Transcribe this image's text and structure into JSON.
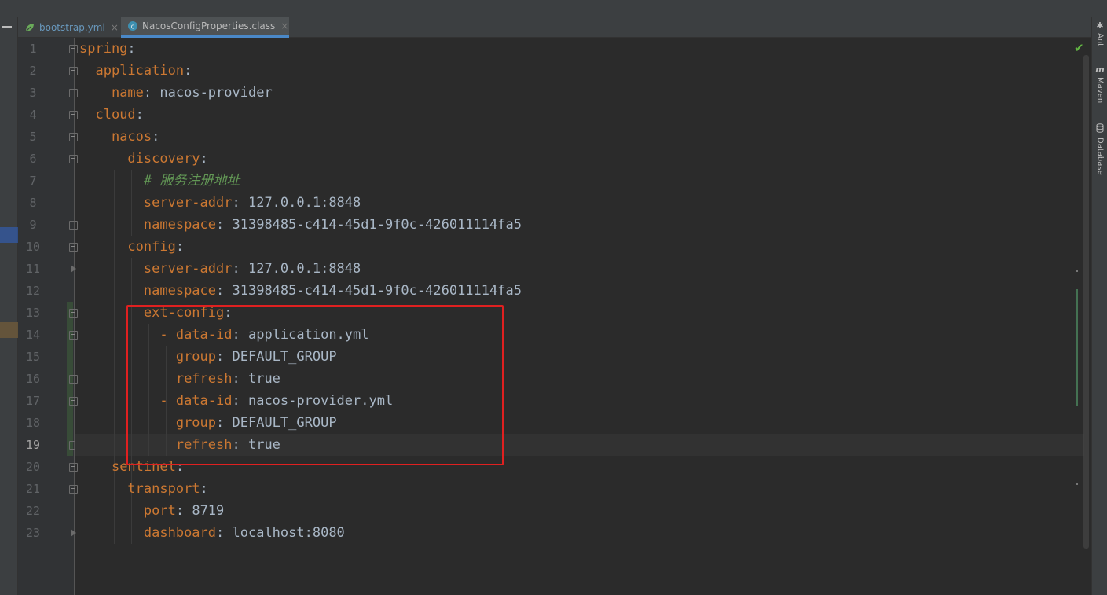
{
  "tabs": [
    {
      "label": "bootstrap.yml",
      "close": "×",
      "icon": "spring-leaf-icon"
    },
    {
      "label": "NacosConfigProperties.class",
      "close": "×",
      "icon": "class-file-icon"
    }
  ],
  "right_tools": [
    {
      "label": "Ant",
      "icon": "ant-icon"
    },
    {
      "label": "Maven",
      "icon": "maven-icon"
    },
    {
      "label": "Database",
      "icon": "database-icon"
    }
  ],
  "status": {
    "inspection": "✔"
  },
  "editor": {
    "current_line": 19,
    "lines": [
      {
        "n": "1",
        "indent": "",
        "key": "spring",
        "value": ""
      },
      {
        "n": "2",
        "indent": "  ",
        "key": "application",
        "value": ""
      },
      {
        "n": "3",
        "indent": "    ",
        "key": "name",
        "value": " nacos-provider"
      },
      {
        "n": "4",
        "indent": "  ",
        "key": "cloud",
        "value": ""
      },
      {
        "n": "5",
        "indent": "    ",
        "key": "nacos",
        "value": ""
      },
      {
        "n": "6",
        "indent": "      ",
        "key": "discovery",
        "value": ""
      },
      {
        "n": "7",
        "indent": "        ",
        "comment": "# 服务注册地址"
      },
      {
        "n": "8",
        "indent": "        ",
        "key": "server-addr",
        "value": " 127.0.0.1:8848"
      },
      {
        "n": "9",
        "indent": "        ",
        "key": "namespace",
        "value": " 31398485-c414-45d1-9f0c-426011114fa5"
      },
      {
        "n": "10",
        "indent": "      ",
        "key": "config",
        "value": ""
      },
      {
        "n": "11",
        "indent": "        ",
        "key": "server-addr",
        "value": " 127.0.0.1:8848"
      },
      {
        "n": "12",
        "indent": "        ",
        "key": "namespace",
        "value": " 31398485-c414-45d1-9f0c-426011114fa5"
      },
      {
        "n": "13",
        "indent": "        ",
        "key": "ext-config",
        "value": ""
      },
      {
        "n": "14",
        "indent": "          - ",
        "key": "data-id",
        "value": " application.yml"
      },
      {
        "n": "15",
        "indent": "            ",
        "key": "group",
        "value": " DEFAULT_GROUP"
      },
      {
        "n": "16",
        "indent": "            ",
        "key": "refresh",
        "value": " true"
      },
      {
        "n": "17",
        "indent": "          - ",
        "key": "data-id",
        "value": " nacos-provider.yml"
      },
      {
        "n": "18",
        "indent": "            ",
        "key": "group",
        "value": " DEFAULT_GROUP"
      },
      {
        "n": "19",
        "indent": "            ",
        "key": "refresh",
        "value": " true"
      },
      {
        "n": "20",
        "indent": "    ",
        "key": "sentinel",
        "value": ""
      },
      {
        "n": "21",
        "indent": "      ",
        "key": "transport",
        "value": ""
      },
      {
        "n": "22",
        "indent": "        ",
        "key": "port",
        "value": " 8719"
      },
      {
        "n": "23",
        "indent": "        ",
        "key": "dashboard",
        "value": " localhost:8080"
      }
    ],
    "folds": [
      "open",
      "open",
      "close",
      "open",
      "open",
      "open",
      "",
      "",
      "close",
      "open",
      "arrow",
      "",
      "open",
      "open",
      "",
      "close",
      "open",
      "",
      "close",
      "open",
      "open",
      "",
      "arrow"
    ]
  },
  "colors": {
    "key": "#cc7832",
    "text": "#a9b7c6",
    "comment": "#629755",
    "highlight_box": "#e02020"
  }
}
